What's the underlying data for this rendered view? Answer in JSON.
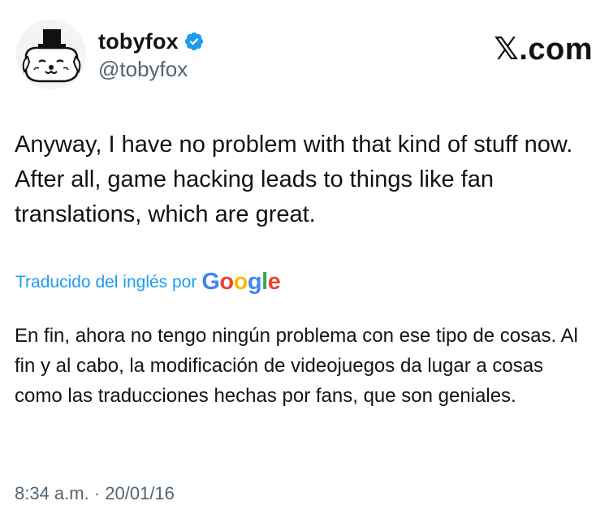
{
  "author": {
    "display_name": "tobyfox",
    "handle": "@tobyfox",
    "verified": true
  },
  "brand": "𝕏.com",
  "tweet": {
    "text": "Anyway, I have no problem with that kind of stuff now. After all, game hacking leads to things like fan translations, which are great."
  },
  "translation": {
    "label": "Traducido del inglés por",
    "provider": "Google",
    "text": "En fin, ahora no tengo ningún problema con ese tipo de cosas. Al fin y al cabo, la modificación de videojuegos da lugar a cosas como las traducciones hechas por fans, que son geniales."
  },
  "timestamp": "8:34 a.m. · 20/01/16",
  "colors": {
    "link_blue": "#1d9bf0",
    "secondary_text": "#536471",
    "primary_text": "#0f1419"
  },
  "icons": [
    "avatar-dog-with-top-hat",
    "verified-badge-icon"
  ]
}
